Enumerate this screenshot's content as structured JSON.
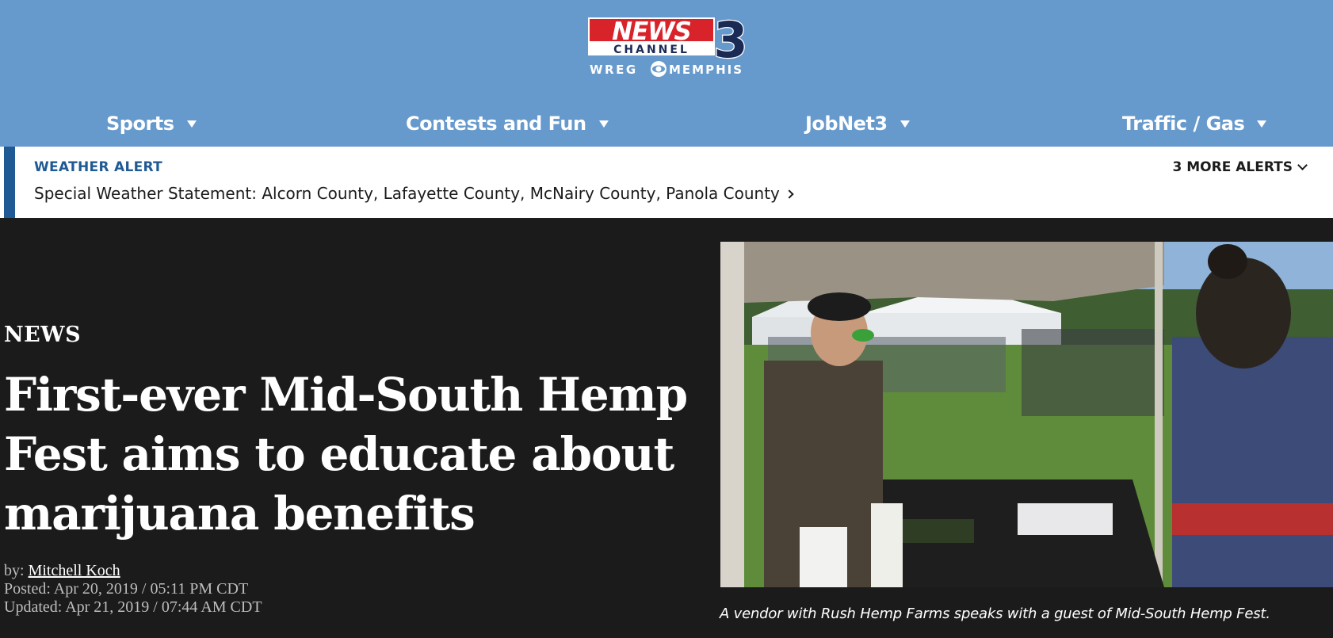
{
  "logo": {
    "news": "NEWS",
    "channel": "CHANNEL",
    "number": "3",
    "wreg": "WREG",
    "memphis": "MEMPHIS"
  },
  "nav": {
    "items": [
      {
        "label": "Sports"
      },
      {
        "label": "Contests and Fun"
      },
      {
        "label": "JobNet3"
      },
      {
        "label": "Traffic / Gas"
      }
    ]
  },
  "weather_alert": {
    "title": "WEATHER ALERT",
    "text": "Special Weather Statement: Alcorn County, Lafayette County, McNairy County, Panola County",
    "more": "3 MORE ALERTS"
  },
  "article": {
    "category": "NEWS",
    "headline": "First-ever Mid-South Hemp Fest aims to educate about marijuana benefits",
    "byline_prefix": "by: ",
    "author": "Mitchell Koch",
    "posted": "Posted: Apr 20, 2019 / 05:11 PM CDT",
    "updated": "Updated: Apr 21, 2019 / 07:44 AM CDT",
    "caption": "A vendor with Rush Hemp Farms speaks with a guest of Mid-South Hemp Fest."
  },
  "colors": {
    "header_bg": "#6699cc",
    "alert_accent": "#1f5a94",
    "article_bg": "#1b1b1b",
    "logo_red": "#d8232a"
  },
  "icons": [
    "caret-down-icon",
    "chevron-right-icon",
    "chevron-down-icon",
    "cbs-eye-icon"
  ]
}
